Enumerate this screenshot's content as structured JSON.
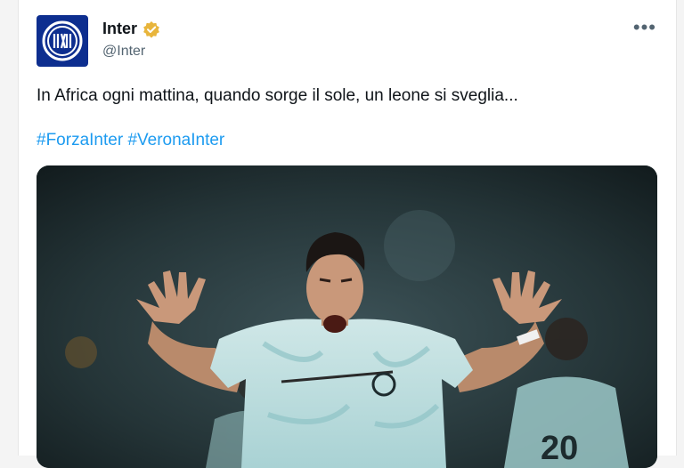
{
  "tweet": {
    "author_name": "Inter",
    "author_handle": "@Inter",
    "more_label": "•••",
    "text": "In Africa ogni mattina, quando sorge il sole, un leone si sveglia...",
    "hashtags": [
      "#ForzaInter",
      "#VeronaInter"
    ],
    "verified_badge_color": "#e8b53c",
    "avatar_color": "#0d2e8f"
  },
  "media": {
    "jersey_number": "20"
  }
}
